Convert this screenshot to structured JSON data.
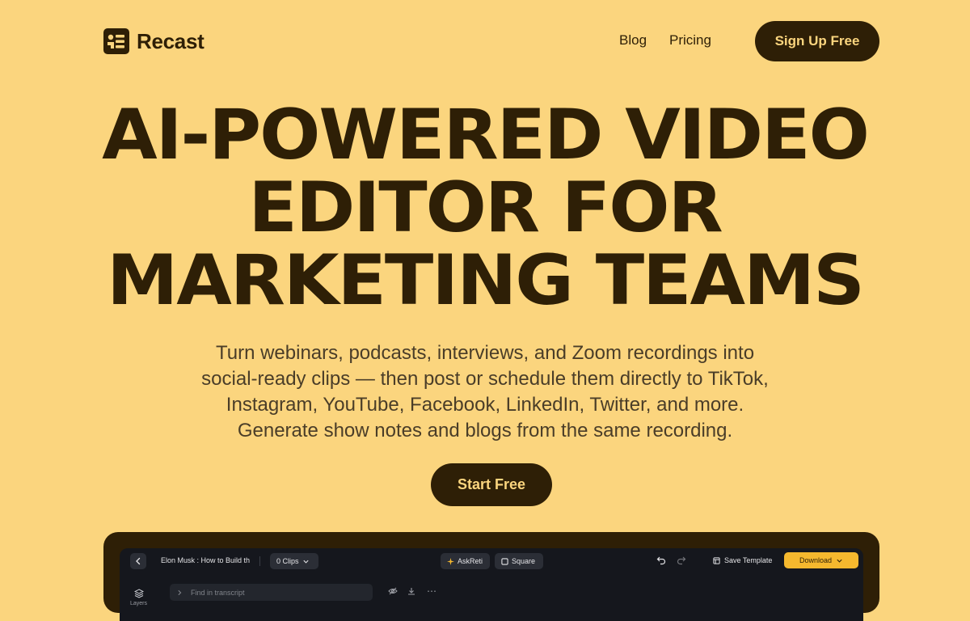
{
  "nav": {
    "brand": "Recast",
    "links": [
      "Blog",
      "Pricing"
    ],
    "cta": "Sign Up Free"
  },
  "hero": {
    "title_lines": [
      "AI-POWERED VIDEO",
      "EDITOR FOR",
      "MARKETING TEAMS"
    ],
    "subtitle_lines": [
      "Turn webinars, podcasts, interviews, and Zoom recordings into",
      "social-ready clips — then post or schedule them directly to TikTok,",
      "Instagram, YouTube, Facebook, LinkedIn, Twitter, and more.",
      "Generate show notes and blogs from the same recording."
    ],
    "cta": "Start Free"
  },
  "editor": {
    "project_title": "Elon Musk : How to Build th",
    "clips_label": "0 Clips",
    "askreti_label": "AskReti",
    "square_label": "Square",
    "save_template_label": "Save Template",
    "download_label": "Download",
    "layers_label": "Layers",
    "find_placeholder": "Find in transcript"
  },
  "colors": {
    "background": "#fbd57e",
    "primary": "#2e1f06",
    "editor_bg": "#15171d",
    "download_accent": "#f5b82e"
  }
}
